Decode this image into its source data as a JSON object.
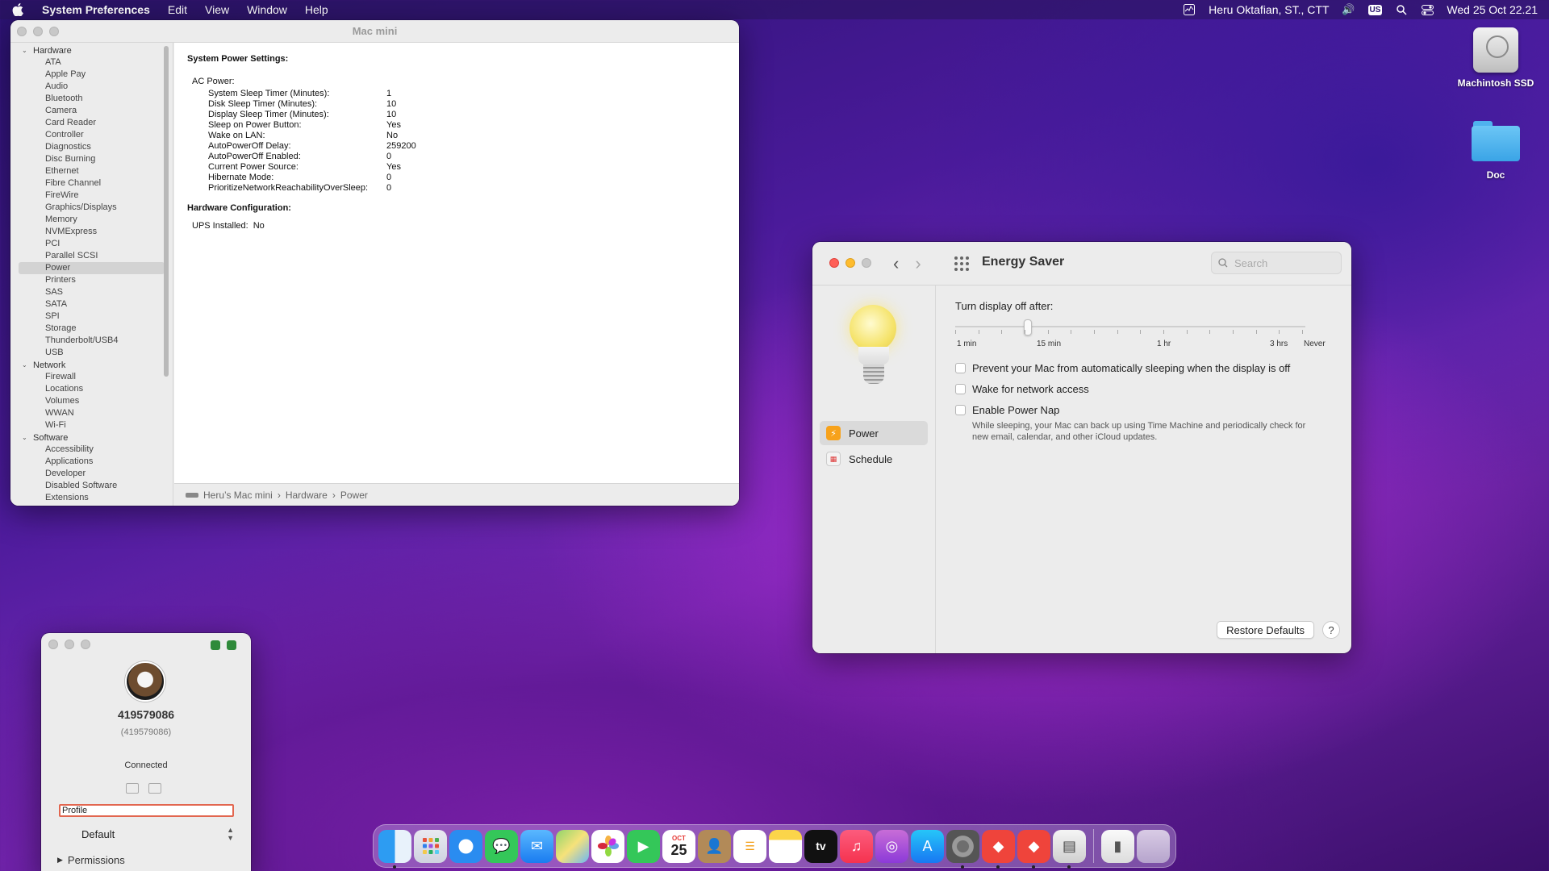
{
  "menubar": {
    "app_name": "System Preferences",
    "menus": [
      "Edit",
      "View",
      "Window",
      "Help"
    ],
    "user": "Heru Oktafian, ST., CTT",
    "input_source": "US",
    "clock": "Wed 25 Oct  22.21"
  },
  "sysinfo": {
    "title": "Mac mini",
    "sidebar": [
      {
        "type": "group",
        "label": "Hardware"
      },
      {
        "type": "item",
        "label": "ATA"
      },
      {
        "type": "item",
        "label": "Apple Pay"
      },
      {
        "type": "item",
        "label": "Audio"
      },
      {
        "type": "item",
        "label": "Bluetooth"
      },
      {
        "type": "item",
        "label": "Camera"
      },
      {
        "type": "item",
        "label": "Card Reader"
      },
      {
        "type": "item",
        "label": "Controller"
      },
      {
        "type": "item",
        "label": "Diagnostics"
      },
      {
        "type": "item",
        "label": "Disc Burning"
      },
      {
        "type": "item",
        "label": "Ethernet"
      },
      {
        "type": "item",
        "label": "Fibre Channel"
      },
      {
        "type": "item",
        "label": "FireWire"
      },
      {
        "type": "item",
        "label": "Graphics/Displays"
      },
      {
        "type": "item",
        "label": "Memory"
      },
      {
        "type": "item",
        "label": "NVMExpress"
      },
      {
        "type": "item",
        "label": "PCI"
      },
      {
        "type": "item",
        "label": "Parallel SCSI"
      },
      {
        "type": "item",
        "label": "Power",
        "selected": true
      },
      {
        "type": "item",
        "label": "Printers"
      },
      {
        "type": "item",
        "label": "SAS"
      },
      {
        "type": "item",
        "label": "SATA"
      },
      {
        "type": "item",
        "label": "SPI"
      },
      {
        "type": "item",
        "label": "Storage"
      },
      {
        "type": "item",
        "label": "Thunderbolt/USB4"
      },
      {
        "type": "item",
        "label": "USB"
      },
      {
        "type": "group",
        "label": "Network"
      },
      {
        "type": "item",
        "label": "Firewall"
      },
      {
        "type": "item",
        "label": "Locations"
      },
      {
        "type": "item",
        "label": "Volumes"
      },
      {
        "type": "item",
        "label": "WWAN"
      },
      {
        "type": "item",
        "label": "Wi-Fi"
      },
      {
        "type": "group",
        "label": "Software"
      },
      {
        "type": "item",
        "label": "Accessibility"
      },
      {
        "type": "item",
        "label": "Applications"
      },
      {
        "type": "item",
        "label": "Developer"
      },
      {
        "type": "item",
        "label": "Disabled Software"
      },
      {
        "type": "item",
        "label": "Extensions"
      }
    ],
    "content": {
      "section_title": "System Power Settings:",
      "ac_power_label": "AC Power:",
      "rows": [
        {
          "k": "System Sleep Timer (Minutes):",
          "v": "1"
        },
        {
          "k": "Disk Sleep Timer (Minutes):",
          "v": "10"
        },
        {
          "k": "Display Sleep Timer (Minutes):",
          "v": "10"
        },
        {
          "k": "Sleep on Power Button:",
          "v": "Yes"
        },
        {
          "k": "Wake on LAN:",
          "v": "No"
        },
        {
          "k": "AutoPowerOff Delay:",
          "v": "259200"
        },
        {
          "k": "AutoPowerOff Enabled:",
          "v": "0"
        },
        {
          "k": "Current Power Source:",
          "v": "Yes"
        },
        {
          "k": "Hibernate Mode:",
          "v": "0"
        },
        {
          "k": "PrioritizeNetworkReachabilityOverSleep:",
          "v": "0"
        }
      ],
      "hw_title": "Hardware Configuration:",
      "ups_label": "UPS Installed:",
      "ups_value": "No"
    },
    "pathbar": [
      "Heru’s Mac mini",
      "Hardware",
      "Power"
    ]
  },
  "energy": {
    "title": "Energy Saver",
    "search_placeholder": "Search",
    "panes": [
      {
        "label": "Power",
        "selected": true
      },
      {
        "label": "Schedule"
      }
    ],
    "display_off_label": "Turn display off after:",
    "slider_labels": [
      "1 min",
      "15 min",
      "1 hr",
      "3 hrs",
      "Never"
    ],
    "slider_value": "15 min",
    "checkboxes": [
      {
        "label": "Prevent your Mac from automatically sleeping when the display is off",
        "checked": false
      },
      {
        "label": "Wake for network access",
        "checked": false
      },
      {
        "label": "Enable Power Nap",
        "checked": false
      }
    ],
    "power_nap_desc": "While sleeping, your Mac can back up using Time Machine and periodically check for new email, calendar, and other iCloud updates.",
    "restore_button": "Restore Defaults",
    "help_button": "?"
  },
  "anydesk": {
    "id": "419579086",
    "id_sub": "(419579086)",
    "status": "Connected",
    "profile_value": "Profile",
    "select_value": "Default",
    "permissions_label": "Permissions"
  },
  "desktop": {
    "disk_label": "Machintosh SSD",
    "folder_label": "Doc"
  },
  "dock": {
    "calendar_month": "OCT",
    "calendar_day": "25",
    "tv_label": "tv"
  },
  "colors": {
    "accent": "#ff5f57",
    "power_icon": "#f7a21b",
    "profile_border": "#e2664f"
  }
}
